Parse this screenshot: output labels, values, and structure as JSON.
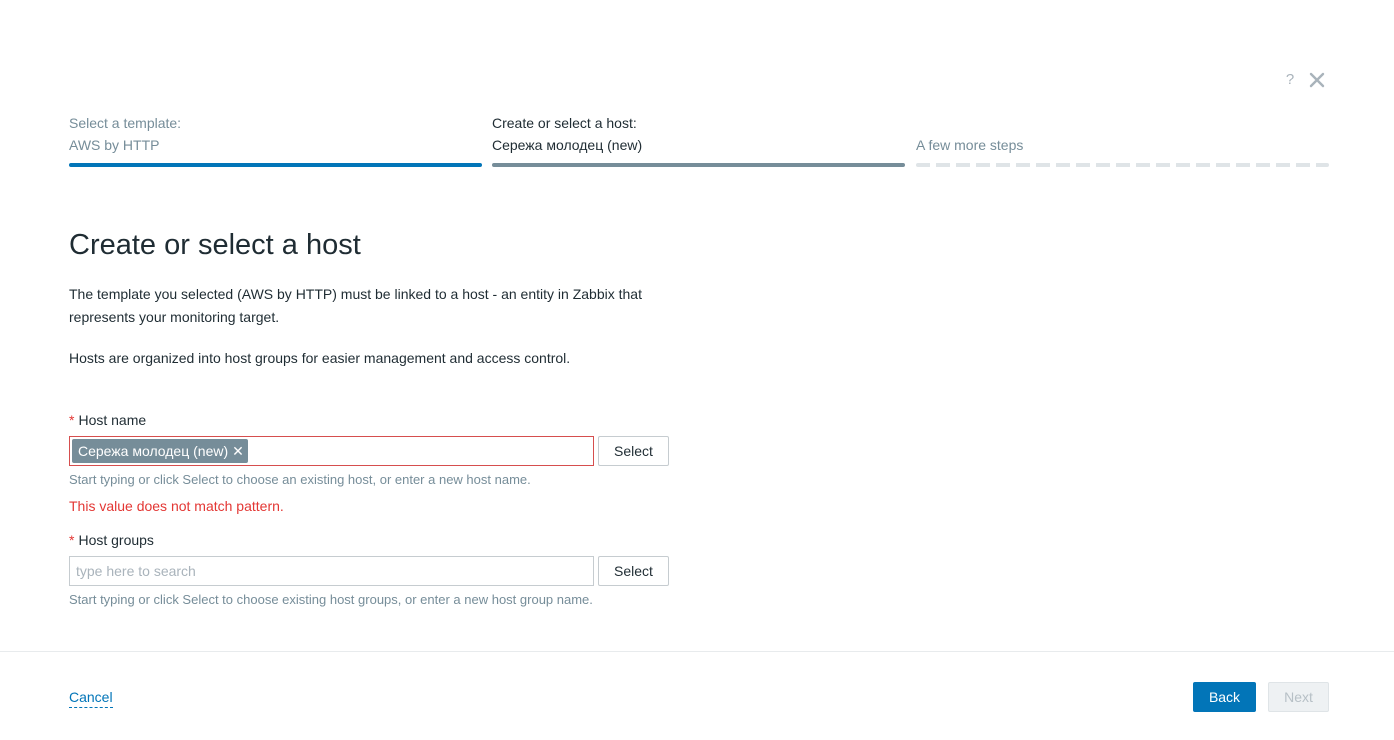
{
  "header": {
    "help_icon": "?",
    "close_icon": "close-icon"
  },
  "steps": [
    {
      "title": "Select a template:",
      "value": "AWS by HTTP",
      "state": "completed",
      "color": "#0275b8"
    },
    {
      "title": "Create or select a host:",
      "value": "Сережа молодец (new)",
      "state": "current",
      "color": "#768d99"
    },
    {
      "title": "",
      "value": "A few more steps",
      "state": "pending",
      "color": "#dfe4e7"
    }
  ],
  "main": {
    "heading": "Create or select a host",
    "description_1": "The template you selected (AWS by HTTP) must be linked to a host - an entity in Zabbix that represents your monitoring target.",
    "description_2": "Hosts are organized into host groups for easier management and access control."
  },
  "host_name": {
    "required_mark": "*",
    "label": "Host name",
    "tag": "Сережа молодец (new)",
    "tag_remove": "✕",
    "select_label": "Select",
    "hint": "Start typing or click Select to choose an existing host, or enter a new host name.",
    "error": "This value does not match pattern."
  },
  "host_groups": {
    "required_mark": "*",
    "label": "Host groups",
    "placeholder": "type here to search",
    "select_label": "Select",
    "hint": "Start typing or click Select to choose existing host groups, or enter a new host group name."
  },
  "footer": {
    "cancel_label": "Cancel",
    "back_label": "Back",
    "next_label": "Next"
  },
  "colors": {
    "accent": "#0275b8",
    "error": "#e33734",
    "muted": "#768d99"
  }
}
